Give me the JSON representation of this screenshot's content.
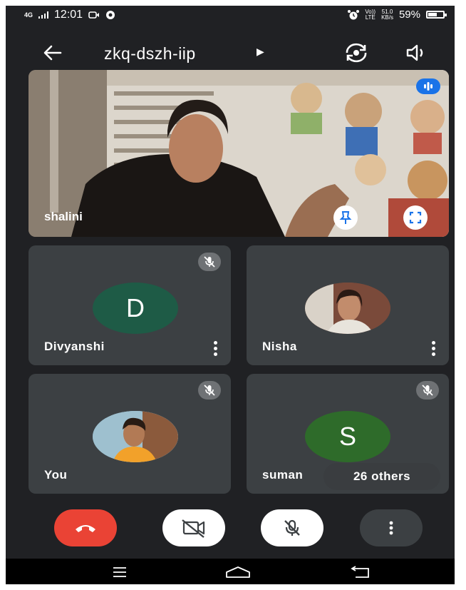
{
  "status_bar": {
    "network": "4G",
    "time": "12:01",
    "data_speed": "51.0",
    "data_unit": "KB/s",
    "lte_top": "Vo))",
    "lte_bottom": "LTE",
    "battery_percent": "59%",
    "battery_level": 0.59
  },
  "header": {
    "meeting_code": "zkq-dszh-iip",
    "back_icon": "arrow-left-icon",
    "switch_camera_icon": "switch-camera-icon",
    "audio_icon": "speaker-icon"
  },
  "main_tile": {
    "participant_name": "shalini",
    "pin_icon": "pin-icon",
    "fullscreen_icon": "fullscreen-icon",
    "speaking_icon": "speaking-indicator-icon"
  },
  "tiles": [
    {
      "name": "Divyanshi",
      "initial": "D",
      "avatar_color": "#1e5b46",
      "muted": true
    },
    {
      "name": "Nisha",
      "initial": "",
      "avatar_color": "#7a4a3a",
      "muted": false
    },
    {
      "name": "You",
      "initial": "",
      "avatar_color": "#8ab4c8",
      "muted": true
    },
    {
      "name": "suman",
      "initial": "S",
      "avatar_color": "#2e6b2a",
      "muted": true
    }
  ],
  "others_badge": "26 others",
  "controls": {
    "end_call_color": "#ea4335",
    "camera_icon": "camera-off-icon",
    "mic_icon": "mic-off-icon",
    "more_icon": "more-vertical-icon"
  },
  "navbar": {
    "menu_icon": "menu-icon",
    "home_icon": "home-icon",
    "back_icon": "back-icon"
  }
}
